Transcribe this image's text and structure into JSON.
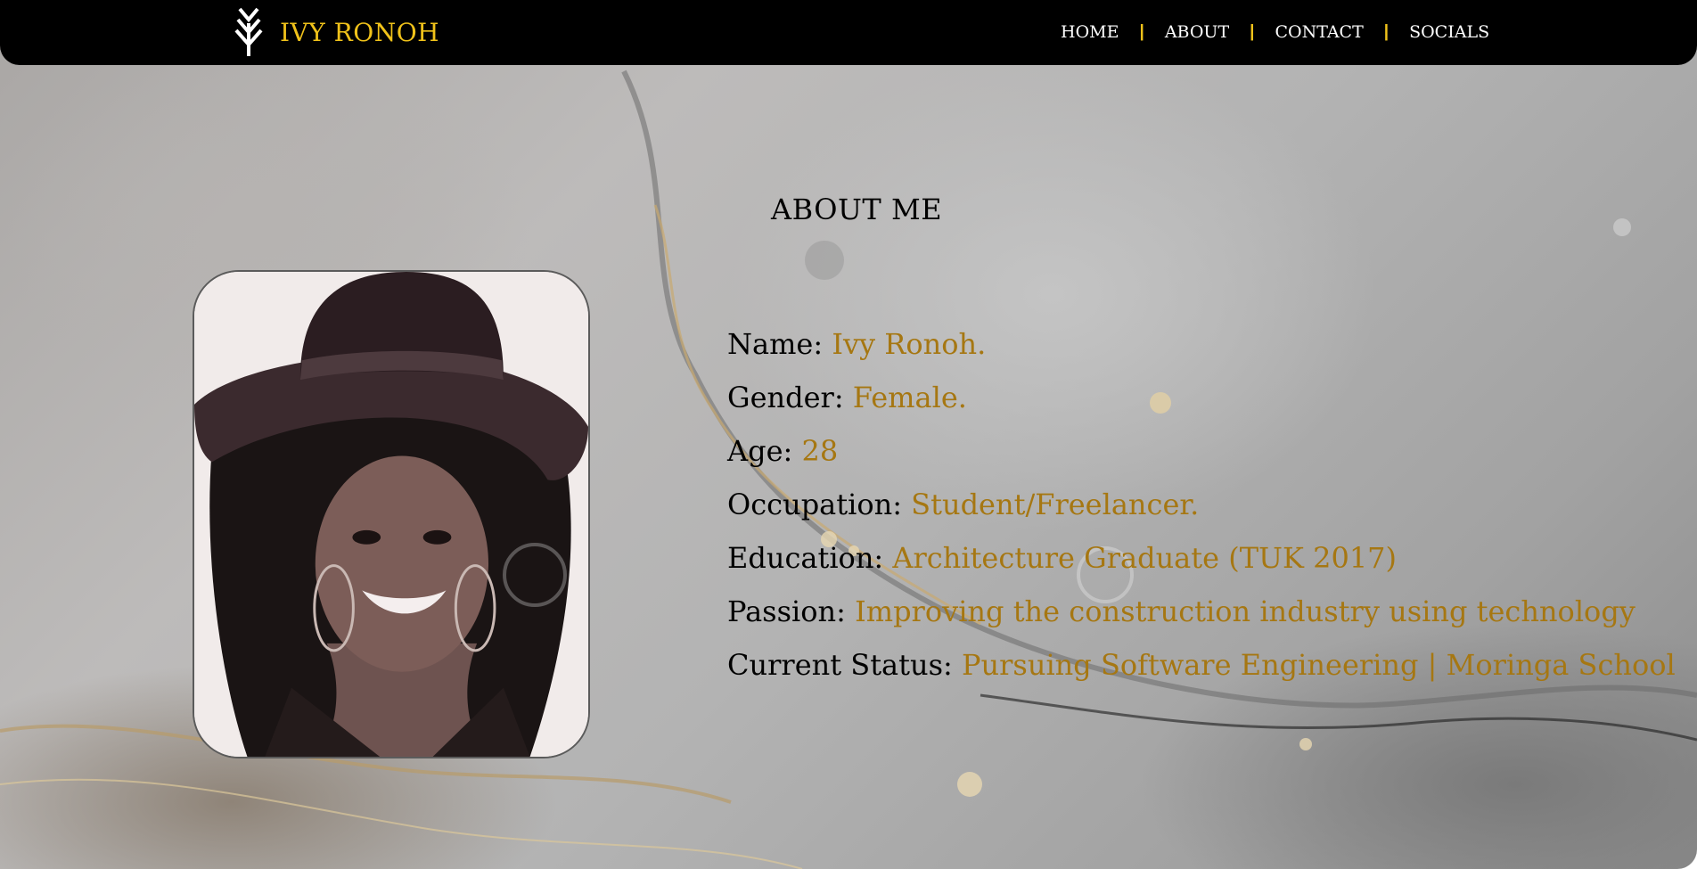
{
  "brand": {
    "name": "IVY RONOH",
    "icon": "arrow-tree-icon"
  },
  "nav": {
    "items": [
      "HOME",
      "ABOUT",
      "CONTACT",
      "SOCIALS"
    ],
    "separator": "|"
  },
  "about": {
    "title": "ABOUT ME",
    "photo": "profile-photo",
    "details": [
      {
        "label": "Name:",
        "value": "Ivy Ronoh."
      },
      {
        "label": "Gender:",
        "value": "Female."
      },
      {
        "label": "Age:",
        "value": "28"
      },
      {
        "label": "Occupation:",
        "value": "Student/Freelancer."
      },
      {
        "label": "Education:",
        "value": "Architecture Graduate (TUK 2017)"
      },
      {
        "label": "Passion:",
        "value": "Improving the construction industry using technology"
      },
      {
        "label": "Current Status:",
        "value": "Pursuing Software Engineering | Moringa School"
      }
    ]
  },
  "colors": {
    "accent": "#f0c21a",
    "value_text": "#a67712",
    "navbar": "#000000"
  }
}
